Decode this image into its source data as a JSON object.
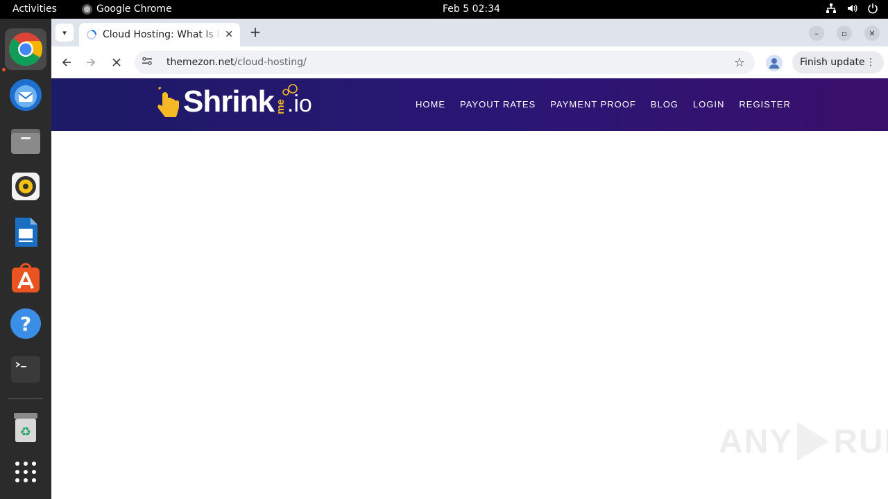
{
  "topbar": {
    "activities": "Activities",
    "app_name": "Google Chrome",
    "clock": "Feb 5  02:34"
  },
  "dock": {
    "items": [
      "chrome",
      "thunderbird",
      "files",
      "rhythmbox",
      "libreoffice-writer",
      "app-center",
      "help",
      "terminal",
      "trash",
      "show-apps"
    ]
  },
  "browser": {
    "tab": {
      "title": "Cloud Hosting: What Is It"
    },
    "url_host": "themezon.net",
    "url_path": "/cloud-hosting/",
    "finish_update": "Finish update"
  },
  "site": {
    "logo_text": "Shrink",
    "logo_me": "me",
    "logo_io": ".io",
    "nav": [
      "HOME",
      "PAYOUT RATES",
      "PAYMENT PROOF",
      "BLOG",
      "LOGIN",
      "REGISTER"
    ]
  },
  "watermark": {
    "left": "ANY",
    "right": "RUN"
  },
  "colors": {
    "header_gradient_start": "#1d1a66",
    "header_gradient_end": "#3a0f6b",
    "logo_accent": "#f5b925",
    "ubuntu_orange": "#e95420"
  }
}
